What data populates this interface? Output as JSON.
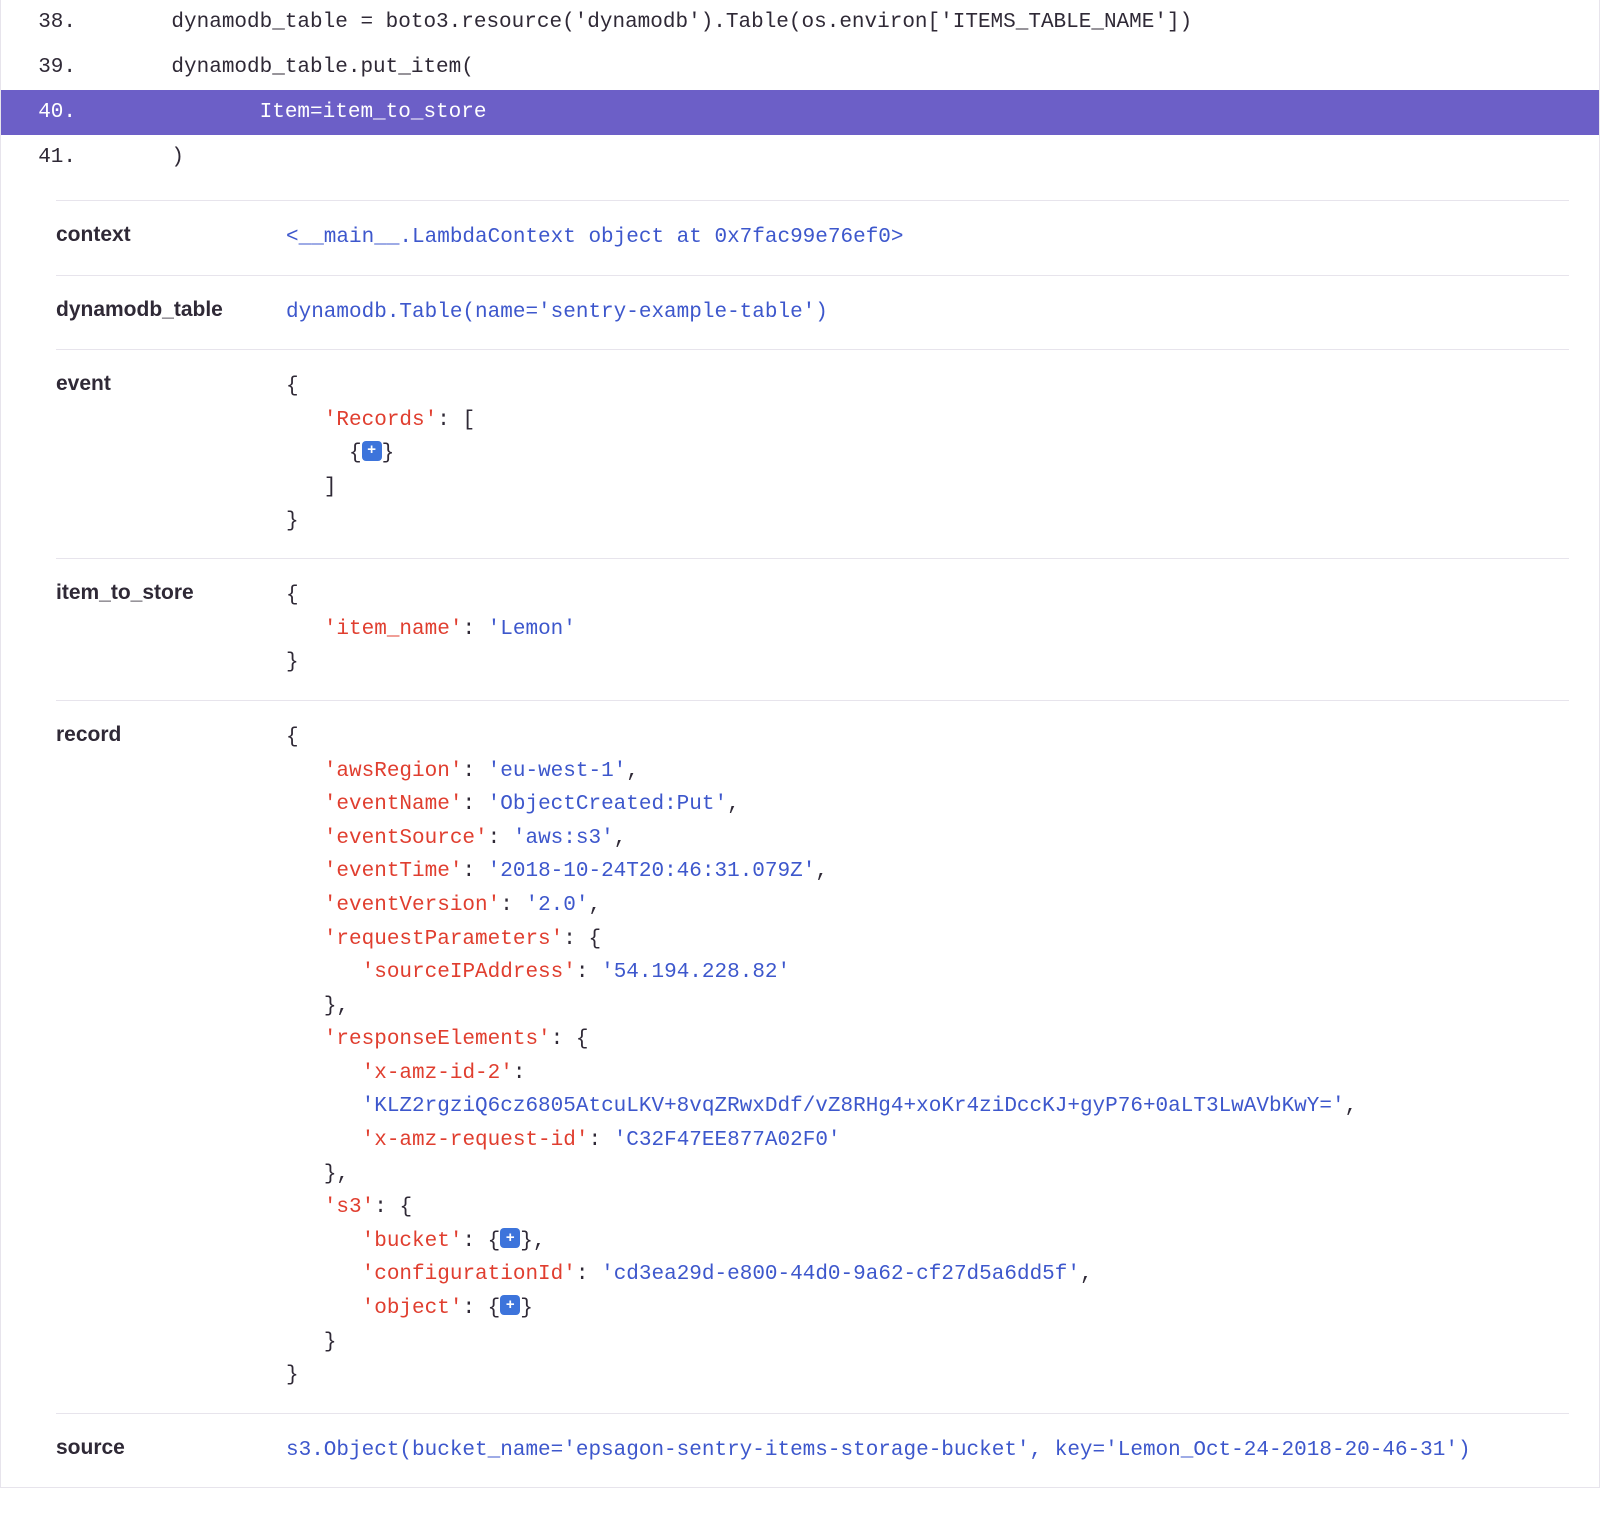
{
  "code": {
    "lines": [
      {
        "num": "38.",
        "text": "    dynamodb_table = boto3.resource('dynamodb').Table(os.environ['ITEMS_TABLE_NAME'])",
        "highlighted": false
      },
      {
        "num": "39.",
        "text": "    dynamodb_table.put_item(",
        "highlighted": false
      },
      {
        "num": "40.",
        "text": "           Item=item_to_store",
        "highlighted": true
      },
      {
        "num": "41.",
        "text": "    )",
        "highlighted": false
      }
    ]
  },
  "vars": {
    "context": {
      "name": "context",
      "value": "<__main__.LambdaContext object at 0x7fac99e76ef0>"
    },
    "dynamodb_table": {
      "name": "dynamodb_table",
      "value": "dynamodb.Table(name='sentry-example-table')"
    },
    "event": {
      "name": "event",
      "records_key": "'Records'"
    },
    "item_to_store": {
      "name": "item_to_store",
      "item_name_key": "'item_name'",
      "item_name_val": "'Lemon'"
    },
    "record": {
      "name": "record",
      "awsRegion_key": "'awsRegion'",
      "awsRegion_val": "'eu-west-1'",
      "eventName_key": "'eventName'",
      "eventName_val": "'ObjectCreated:Put'",
      "eventSource_key": "'eventSource'",
      "eventSource_val": "'aws:s3'",
      "eventTime_key": "'eventTime'",
      "eventTime_val": "'2018-10-24T20:46:31.079Z'",
      "eventVersion_key": "'eventVersion'",
      "eventVersion_val": "'2.0'",
      "requestParameters_key": "'requestParameters'",
      "sourceIPAddress_key": "'sourceIPAddress'",
      "sourceIPAddress_val": "'54.194.228.82'",
      "responseElements_key": "'responseElements'",
      "xamzid2_key": "'x-amz-id-2'",
      "xamzid2_val": "'KLZ2rgziQ6cz6805AtcuLKV+8vqZRwxDdf/vZ8RHg4+xoKr4ziDccKJ+gyP76+0aLT3LwAVbKwY='",
      "xamzrequestid_key": "'x-amz-request-id'",
      "xamzrequestid_val": "'C32F47EE877A02F0'",
      "s3_key": "'s3'",
      "bucket_key": "'bucket'",
      "configurationId_key": "'configurationId'",
      "configurationId_val": "'cd3ea29d-e800-44d0-9a62-cf27d5a6dd5f'",
      "object_key": "'object'"
    },
    "source": {
      "name": "source",
      "value": "s3.Object(bucket_name='epsagon-sentry-items-storage-bucket', key='Lemon_Oct-24-2018-20-46-31')"
    }
  },
  "ui": {
    "expand_glyph": "+"
  }
}
